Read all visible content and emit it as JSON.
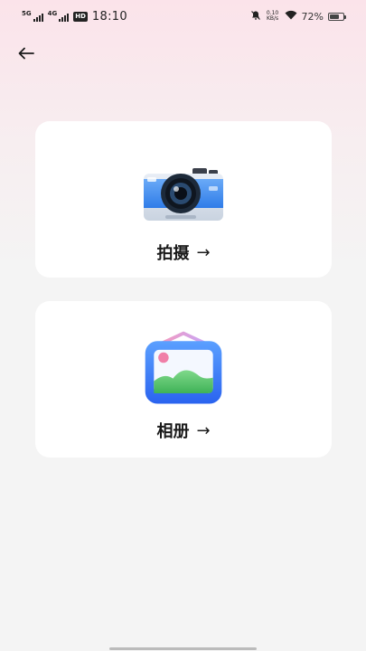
{
  "status_bar": {
    "signal1_label": "5G",
    "signal2_label": "4G",
    "hd_label": "HD",
    "time": "18:10",
    "net_speed_value": "0.10",
    "net_speed_unit": "KB/s",
    "battery_percent": "72%",
    "battery_level": 0.72
  },
  "header": {
    "back_icon": "arrow-left-icon"
  },
  "cards": {
    "camera": {
      "label": "拍摄",
      "arrow": "→",
      "icon": "camera-icon"
    },
    "album": {
      "label": "相册",
      "arrow": "→",
      "icon": "photo-frame-icon"
    }
  },
  "colors": {
    "camera_blue": "#3f8ef0",
    "album_blue": "#3c7ef5",
    "album_pink": "#f07fa8",
    "album_green": "#5cc86a"
  }
}
